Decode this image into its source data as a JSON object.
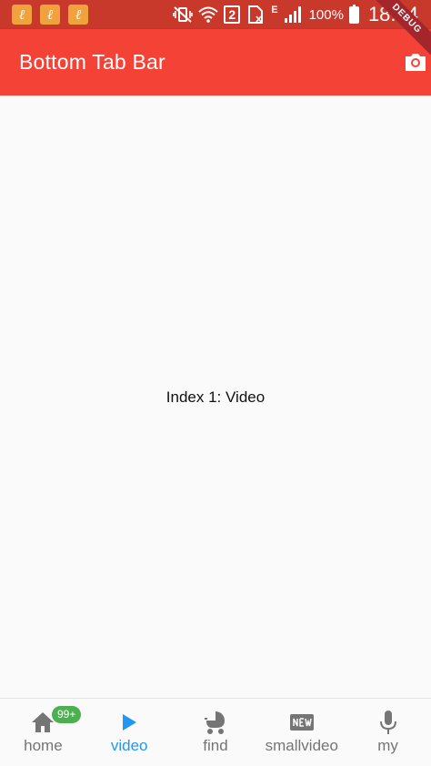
{
  "status_bar": {
    "battery": "100%",
    "time": "18:24",
    "sim_slot": "2",
    "network_type": "E"
  },
  "app_bar": {
    "title": "Bottom Tab Bar",
    "action_icon": "camera-icon"
  },
  "debug_banner": "DEBUG",
  "body": {
    "text": "Index 1: Video"
  },
  "bottom_nav": {
    "selected_index": 1,
    "active_color": "#2196f3",
    "inactive_color": "#757575",
    "items": [
      {
        "label": "home",
        "icon": "home-icon",
        "badge": "99+"
      },
      {
        "label": "video",
        "icon": "play-icon"
      },
      {
        "label": "find",
        "icon": "stroller-icon"
      },
      {
        "label": "smallvideo",
        "icon": "new-icon"
      },
      {
        "label": "my",
        "icon": "microphone-icon"
      }
    ]
  },
  "colors": {
    "app_bar": "#f44336",
    "status_bar": "#c8392c",
    "badge": "#4caf50"
  }
}
